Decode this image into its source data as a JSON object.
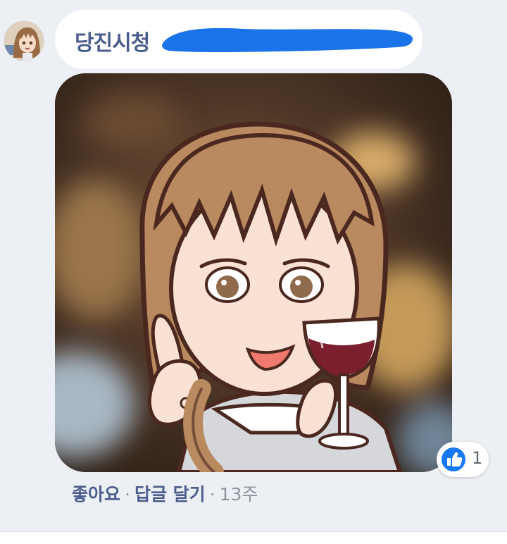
{
  "comment": {
    "author": "당진시청",
    "author_redacted": true,
    "avatar": "cartoon-girl-avatar",
    "sticker": "wine-glass-girl-sticker",
    "reactions": {
      "icon": "thumbs-up-icon",
      "count": "1"
    },
    "actions": {
      "like_label": "좋아요",
      "reply_label": "답글 달기",
      "separator": "·",
      "timestamp": "13주"
    }
  },
  "colors": {
    "background": "#eceff3",
    "name": "#4b5d8d",
    "meta": "#90949c",
    "like_blue": "#1877f2",
    "redaction": "#1a73e8"
  }
}
